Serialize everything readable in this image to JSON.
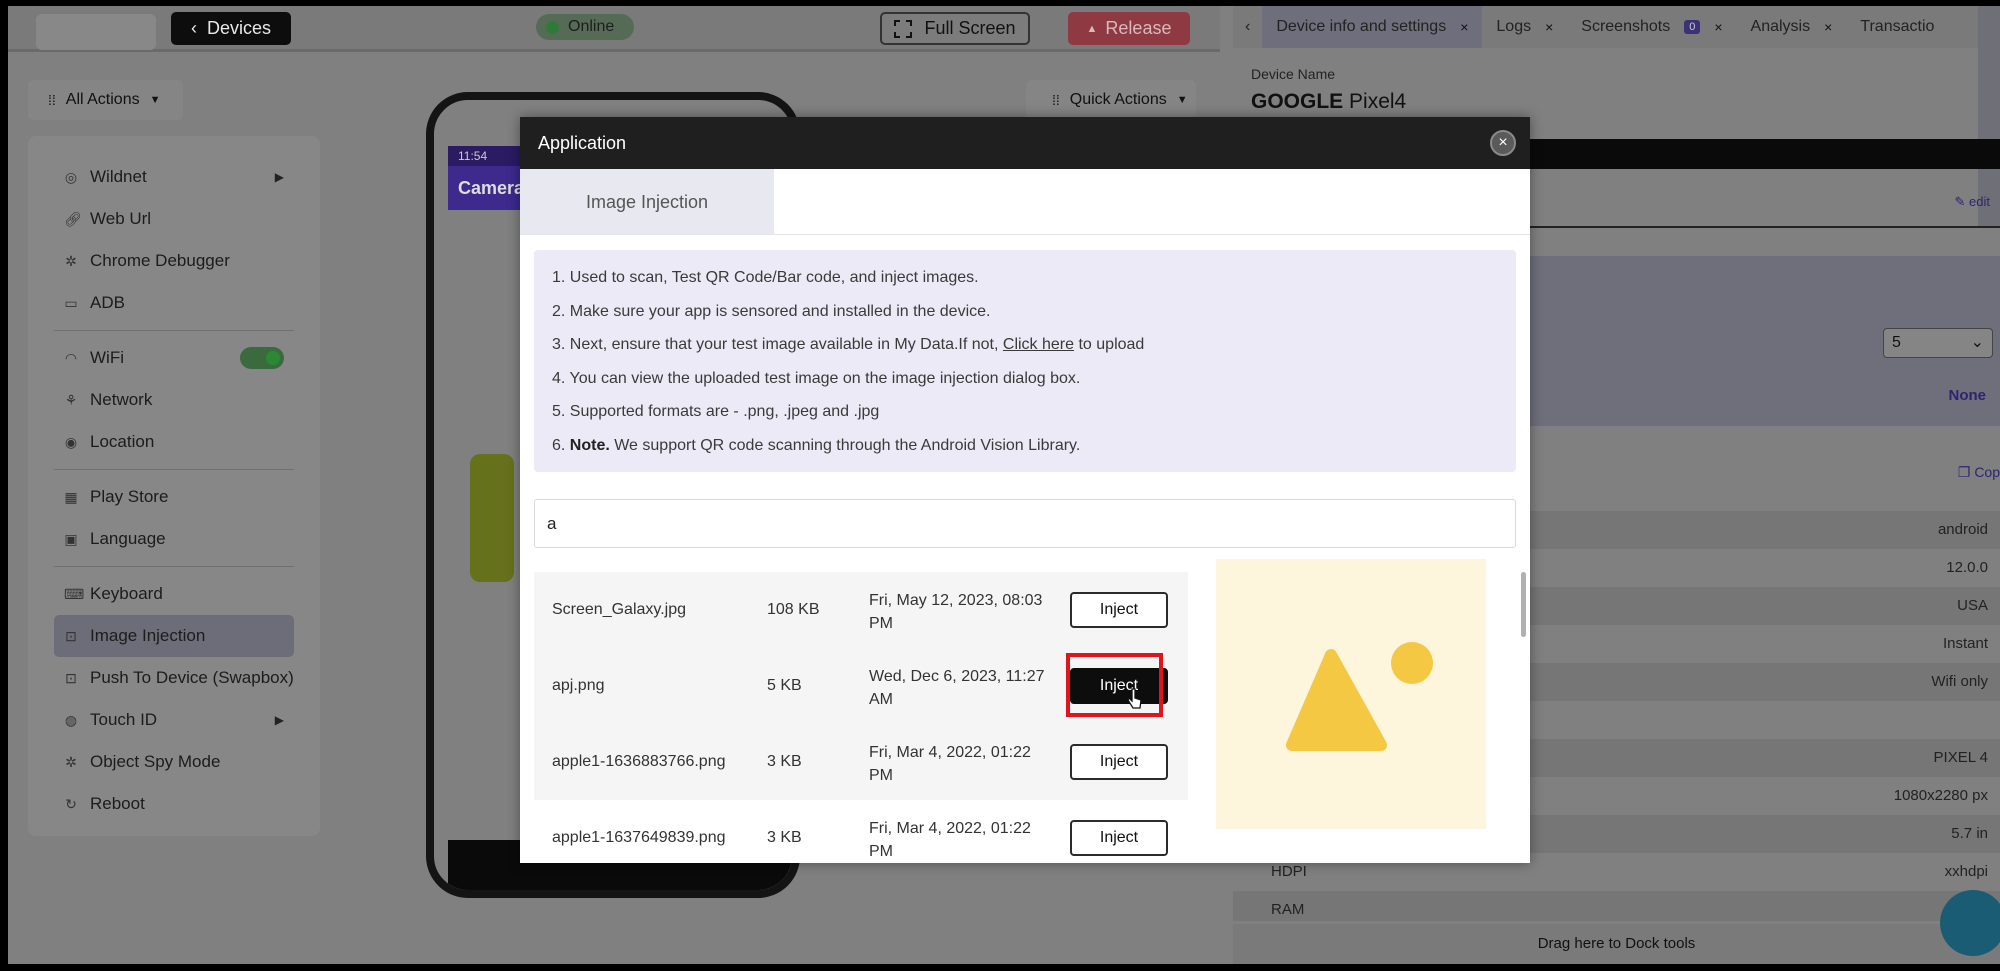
{
  "topbar": {
    "devices_label": "Devices",
    "status_label": "Online",
    "fullscreen_label": "Full Screen",
    "release_label": "Release"
  },
  "left_panel": {
    "all_actions_label": "All Actions",
    "quick_actions_label": "Quick Actions",
    "menu": [
      {
        "label": "Wildnet",
        "icon": "wildnet-icon"
      },
      {
        "label": "Web Url",
        "icon": "link-icon"
      },
      {
        "label": "Chrome Debugger",
        "icon": "bug-icon"
      },
      {
        "label": "ADB",
        "icon": "terminal-icon"
      },
      {
        "label": "WiFi",
        "icon": "wifi-icon"
      },
      {
        "label": "Network",
        "icon": "network-icon"
      },
      {
        "label": "Location",
        "icon": "location-pin-icon"
      },
      {
        "label": "Play Store",
        "icon": "grid-icon"
      },
      {
        "label": "Language",
        "icon": "language-icon"
      },
      {
        "label": "Keyboard",
        "icon": "keyboard-icon"
      },
      {
        "label": "Image Injection",
        "icon": "image-injection-icon"
      },
      {
        "label": "Push To Device (Swapbox)",
        "icon": "push-icon"
      },
      {
        "label": "Touch ID",
        "icon": "fingerprint-icon"
      },
      {
        "label": "Object Spy Mode",
        "icon": "spy-icon"
      },
      {
        "label": "Reboot",
        "icon": "reboot-icon"
      }
    ]
  },
  "phone": {
    "time": "11:54",
    "app_title": "Camera"
  },
  "right_panel": {
    "tabs": [
      {
        "label": "Device info and settings"
      },
      {
        "label": "Logs"
      },
      {
        "label": "Screenshots",
        "badge": "0"
      },
      {
        "label": "Analysis"
      },
      {
        "label": "Transactio"
      }
    ],
    "device_name_label": "Device Name",
    "device_brand": "GOOGLE",
    "device_model": "Pixel4",
    "edit_label": "edit",
    "select_value": "5",
    "none_label": "None",
    "copy_label": "Cop",
    "properties": [
      {
        "key": "",
        "value": "android"
      },
      {
        "key": "",
        "value": "12.0.0"
      },
      {
        "key": "",
        "value": "USA"
      },
      {
        "key": "",
        "value": "Instant"
      },
      {
        "key": "",
        "value": "Wifi only"
      },
      {
        "key": "",
        "value": ""
      },
      {
        "key": "",
        "value": "PIXEL 4"
      },
      {
        "key": "",
        "value": "1080x2280 px"
      },
      {
        "key": "",
        "value": "5.7 in"
      },
      {
        "key": "HDPI",
        "value": "xxhdpi"
      },
      {
        "key": "RAM",
        "value": ""
      }
    ],
    "dock_label": "Drag here to Dock tools"
  },
  "modal": {
    "title": "Application",
    "tab_label": "Image Injection",
    "info": {
      "line1": "1. Used to scan, Test QR Code/Bar code, and inject images.",
      "line2": "2. Make sure your app is sensored and installed in the device.",
      "line3_pre": "3. Next, ensure that your test image available in My Data.If not, ",
      "line3_link": "Click here",
      "line3_post": " to upload",
      "line4": "4. You can view the uploaded test image on the image injection dialog box.",
      "line5": "5. Supported formats are - .png, .jpeg and .jpg",
      "line6_num": "6. ",
      "line6_bold": "Note.",
      "line6_rest": " We support QR code scanning through the Android Vision Library."
    },
    "search_value": "a",
    "files": [
      {
        "name": "Screen_Galaxy.jpg",
        "size": "108 KB",
        "date": "Fri, May 12, 2023, 08:03 PM",
        "action": "Inject"
      },
      {
        "name": "apj.png",
        "size": "5 KB",
        "date": "Wed, Dec 6, 2023, 11:27 AM",
        "action": "Inject"
      },
      {
        "name": "apple1-1636883766.png",
        "size": "3 KB",
        "date": "Fri, Mar 4, 2022, 01:22 PM",
        "action": "Inject"
      },
      {
        "name": "apple1-1637649839.png",
        "size": "3 KB",
        "date": "Fri, Mar 4, 2022, 01:22 PM",
        "action": "Inject"
      }
    ]
  }
}
